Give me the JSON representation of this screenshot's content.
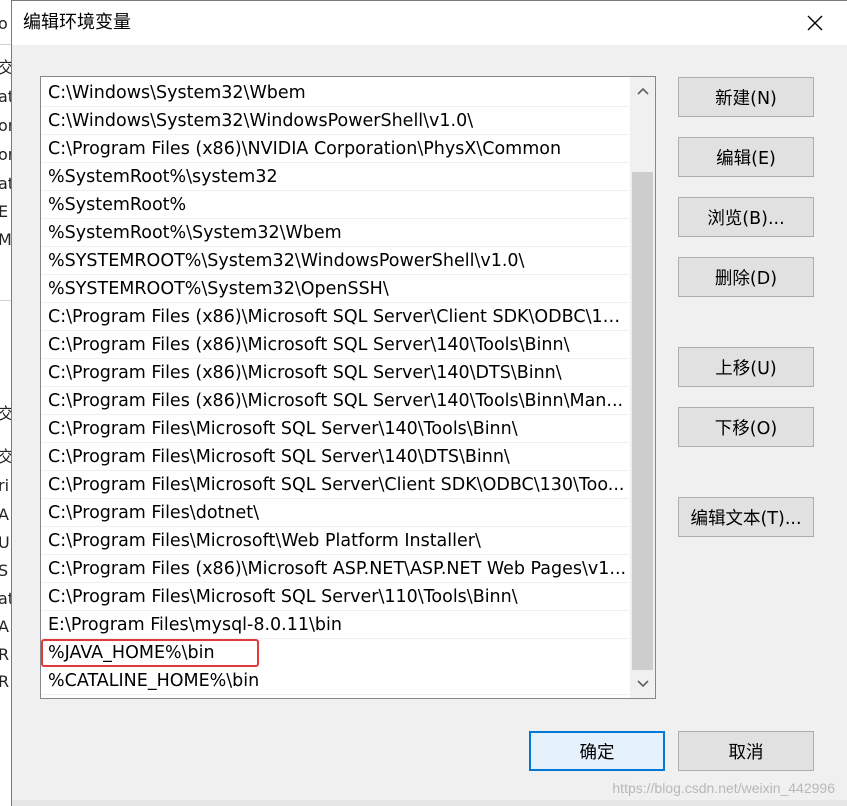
{
  "dialog": {
    "title": "编辑环境变量",
    "close_icon": "close-icon"
  },
  "path_list": {
    "items": [
      "C:\\Windows\\System32\\Wbem",
      "C:\\Windows\\System32\\WindowsPowerShell\\v1.0\\",
      "C:\\Program Files (x86)\\NVIDIA Corporation\\PhysX\\Common",
      "%SystemRoot%\\system32",
      "%SystemRoot%",
      "%SystemRoot%\\System32\\Wbem",
      "%SYSTEMROOT%\\System32\\WindowsPowerShell\\v1.0\\",
      "%SYSTEMROOT%\\System32\\OpenSSH\\",
      "C:\\Program Files (x86)\\Microsoft SQL Server\\Client SDK\\ODBC\\13...",
      "C:\\Program Files (x86)\\Microsoft SQL Server\\140\\Tools\\Binn\\",
      "C:\\Program Files (x86)\\Microsoft SQL Server\\140\\DTS\\Binn\\",
      "C:\\Program Files (x86)\\Microsoft SQL Server\\140\\Tools\\Binn\\Man...",
      "C:\\Program Files\\Microsoft SQL Server\\140\\Tools\\Binn\\",
      "C:\\Program Files\\Microsoft SQL Server\\140\\DTS\\Binn\\",
      "C:\\Program Files\\Microsoft SQL Server\\Client SDK\\ODBC\\130\\Too...",
      "C:\\Program Files\\dotnet\\",
      "C:\\Program Files\\Microsoft\\Web Platform Installer\\",
      "C:\\Program Files (x86)\\Microsoft ASP.NET\\ASP.NET Web Pages\\v1...",
      "C:\\Program Files\\Microsoft SQL Server\\110\\Tools\\Binn\\",
      "E:\\Program Files\\mysql-8.0.11\\bin",
      "%JAVA_HOME%\\bin",
      "%CATALINE_HOME%\\bin"
    ],
    "highlighted_index": 20,
    "highlight_color": "#e23a3a"
  },
  "buttons": {
    "new": "新建(N)",
    "edit": "编辑(E)",
    "browse": "浏览(B)...",
    "delete": "删除(D)",
    "move_up": "上移(U)",
    "move_down": "下移(O)",
    "edit_text": "编辑文本(T)...",
    "ok": "确定",
    "cancel": "取消"
  },
  "background_window": {
    "fragments": [
      "o",
      "交",
      "at",
      "on",
      "on",
      "at",
      "E",
      "M",
      "交",
      "交",
      "ri",
      "A",
      "U",
      "S",
      "at",
      "A",
      "R",
      "R"
    ]
  },
  "watermark": "https://blog.csdn.net/weixin_442996",
  "colors": {
    "accent": "#0078d7",
    "highlight": "#e23a3a"
  }
}
